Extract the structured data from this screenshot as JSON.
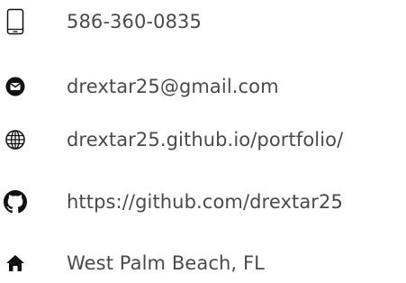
{
  "contact": {
    "items": [
      {
        "icon": "smartphone-icon",
        "text": "586-360-0835"
      },
      {
        "icon": "email-icon",
        "text": "drextar25@gmail.com"
      },
      {
        "icon": "globe-icon",
        "text": "drextar25.github.io/portfolio/"
      },
      {
        "icon": "github-icon",
        "text": "https://github.com/drextar25"
      },
      {
        "icon": "home-icon",
        "text": "West Palm Beach, FL"
      }
    ]
  },
  "colors": {
    "text": "#4a4a4a",
    "icon": "#111111"
  }
}
